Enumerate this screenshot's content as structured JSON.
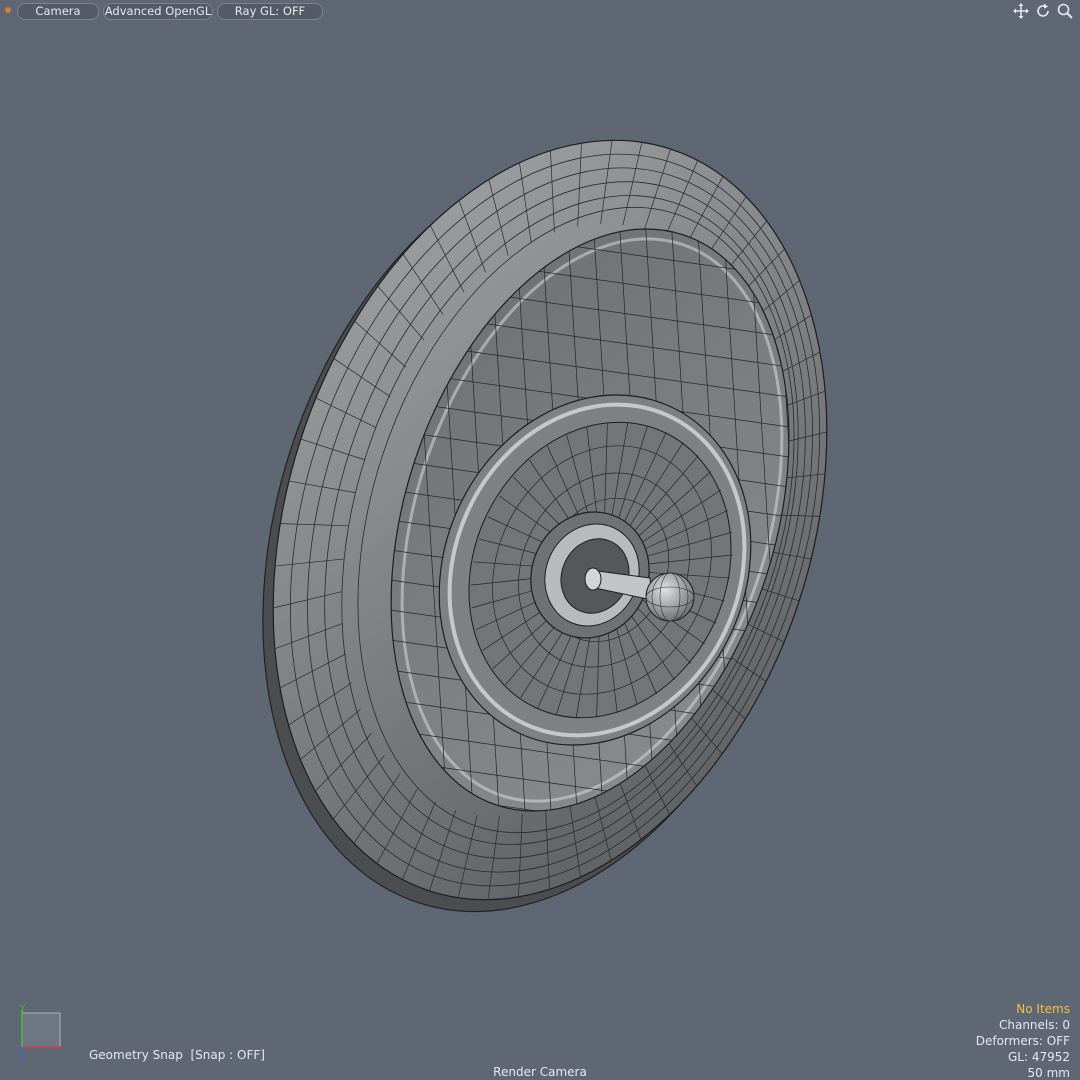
{
  "toolbar": {
    "camera_label": "Camera",
    "opengl_label": "Advanced OpenGL",
    "raygl_label": "Ray GL: OFF",
    "nav_icons": [
      "move-icon",
      "rotate-icon",
      "zoom-icon"
    ]
  },
  "viewport": {
    "background": "#5f6774",
    "model_fill": "#8a8c8f"
  },
  "status": {
    "geometry_snap": "Geometry Snap  [Snap : OFF]",
    "camera_name": "Render Camera",
    "items": "No Items",
    "channels": "Channels: 0",
    "deformers": "Deformers: OFF",
    "gl": "GL: 47952",
    "focal": "50 mm"
  },
  "axis": {
    "y_label": "Y",
    "x_color": "#d04040",
    "y_color": "#40c040",
    "z_color": "#4060d0"
  }
}
